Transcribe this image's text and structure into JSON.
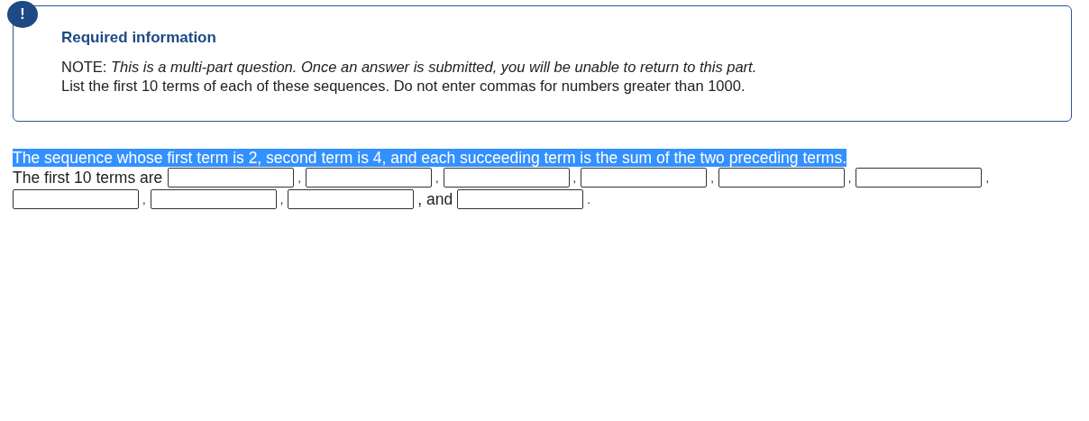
{
  "notice": {
    "badge": "!",
    "title": "Required information",
    "note_label": "NOTE:",
    "note_text": "This is a multi-part question. Once an answer is submitted, you will be unable to return to this part.",
    "instruction": "List the first 10 terms of each of these sequences. Do not enter commas for numbers greater than 1000."
  },
  "question": {
    "text": "The sequence whose first term is 2, second term is 4, and each succeeding term is the sum of the two preceding terms.",
    "highlighted": true
  },
  "answer_line": {
    "lead": "The first 10 terms are",
    "blanks": [
      {
        "after": ","
      },
      {
        "after": ","
      },
      {
        "after": ","
      },
      {
        "after": ","
      },
      {
        "after": ","
      },
      {
        "after": ","
      },
      {
        "after": ","
      },
      {
        "after": ","
      },
      {
        "after": ", and"
      },
      {
        "after": "."
      }
    ]
  }
}
